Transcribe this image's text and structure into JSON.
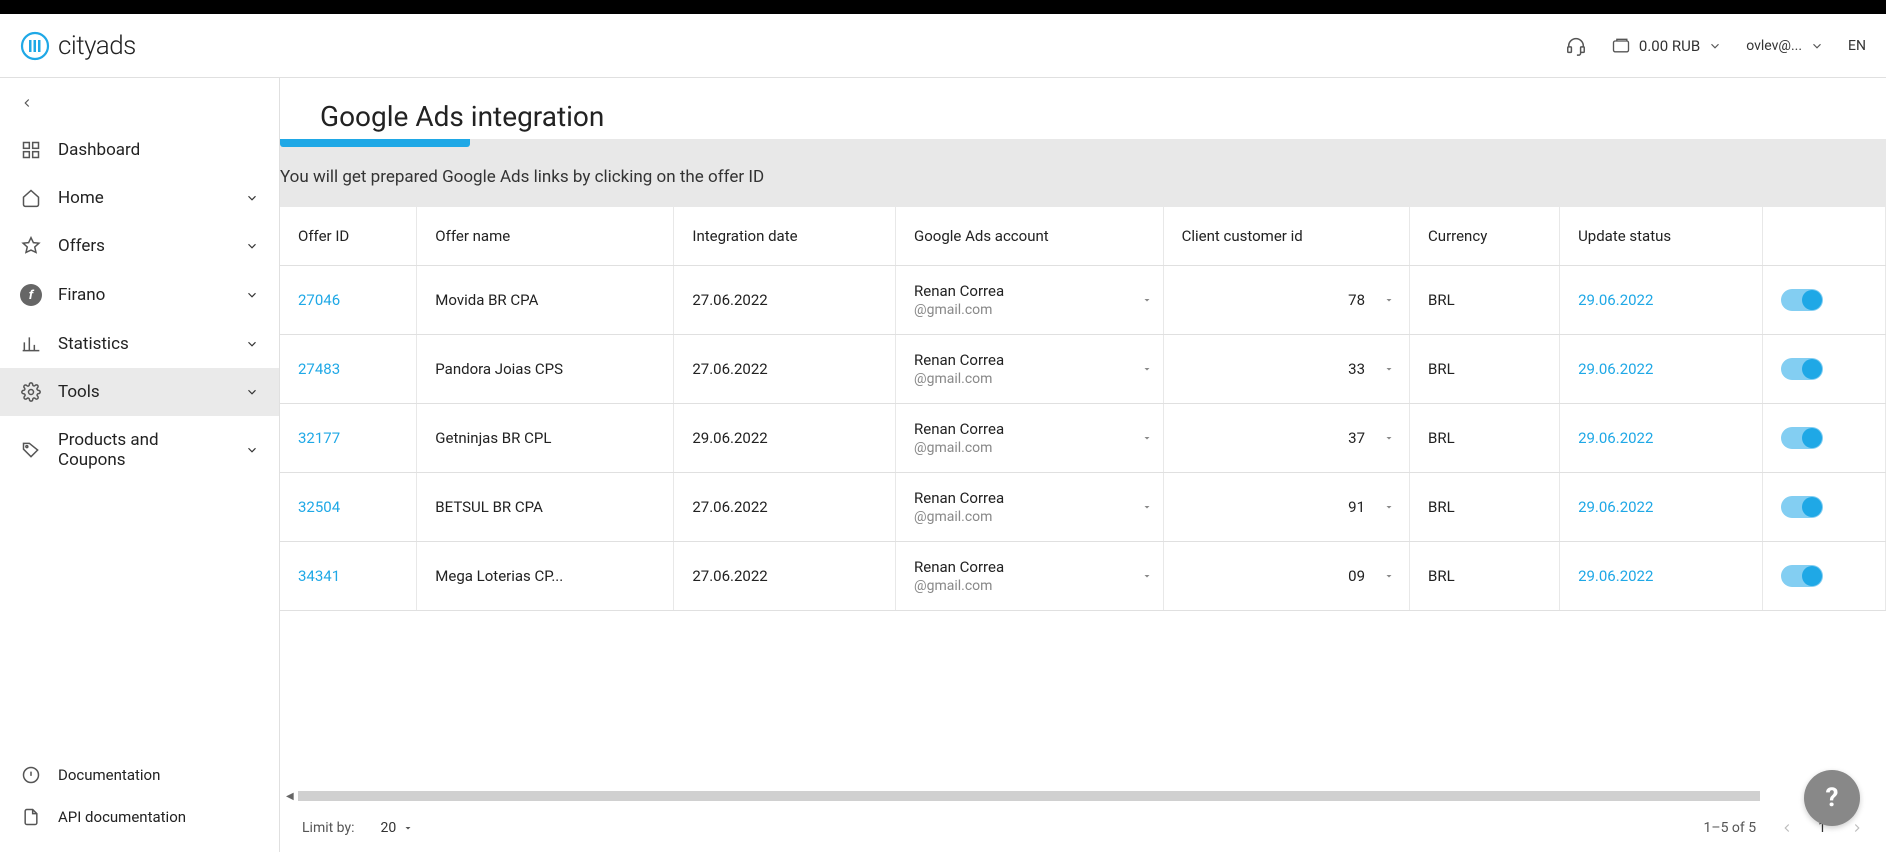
{
  "header": {
    "logo_text": "cityads",
    "balance": "0.00 RUB",
    "user_email": "ovlev@...",
    "language": "EN"
  },
  "sidebar": {
    "items": [
      {
        "label": "Dashboard",
        "has_chevron": false
      },
      {
        "label": "Home",
        "has_chevron": true
      },
      {
        "label": "Offers",
        "has_chevron": true
      },
      {
        "label": "Firano",
        "has_chevron": true
      },
      {
        "label": "Statistics",
        "has_chevron": true
      },
      {
        "label": "Tools",
        "has_chevron": true,
        "active": true
      },
      {
        "label": "Products and Coupons",
        "has_chevron": true
      }
    ],
    "footer": [
      {
        "label": "Documentation"
      },
      {
        "label": "API documentation"
      }
    ]
  },
  "page": {
    "title": "Google Ads integration",
    "info_line": "You will get prepared Google Ads links by clicking on the offer ID"
  },
  "table": {
    "columns": [
      "Offer ID",
      "Offer name",
      "Integration date",
      "Google Ads account",
      "Client customer id",
      "Currency",
      "Update status",
      ""
    ],
    "rows": [
      {
        "offer_id": "27046",
        "offer_name": "Movida BR CPA",
        "integration_date": "27.06.2022",
        "account_name": "Renan Correa",
        "account_email": "@gmail.com",
        "client_customer_id": "78",
        "currency": "BRL",
        "update_status": "29.06.2022"
      },
      {
        "offer_id": "27483",
        "offer_name": "Pandora Joias CPS",
        "integration_date": "27.06.2022",
        "account_name": "Renan Correa",
        "account_email": "@gmail.com",
        "client_customer_id": "33",
        "currency": "BRL",
        "update_status": "29.06.2022"
      },
      {
        "offer_id": "32177",
        "offer_name": "Getninjas BR CPL",
        "integration_date": "29.06.2022",
        "account_name": "Renan Correa",
        "account_email": "@gmail.com",
        "client_customer_id": "37",
        "currency": "BRL",
        "update_status": "29.06.2022"
      },
      {
        "offer_id": "32504",
        "offer_name": "BETSUL BR CPA",
        "integration_date": "27.06.2022",
        "account_name": "Renan Correa",
        "account_email": "@gmail.com",
        "client_customer_id": "91",
        "currency": "BRL",
        "update_status": "29.06.2022"
      },
      {
        "offer_id": "34341",
        "offer_name": "Mega Loterias CP...",
        "integration_date": "27.06.2022",
        "account_name": "Renan Correa",
        "account_email": "@gmail.com",
        "client_customer_id": "09",
        "currency": "BRL",
        "update_status": "29.06.2022"
      }
    ]
  },
  "footer": {
    "limit_label": "Limit by:",
    "limit_value": "20",
    "range": "1–5 of 5",
    "current_page": "1"
  },
  "help_button": "?"
}
